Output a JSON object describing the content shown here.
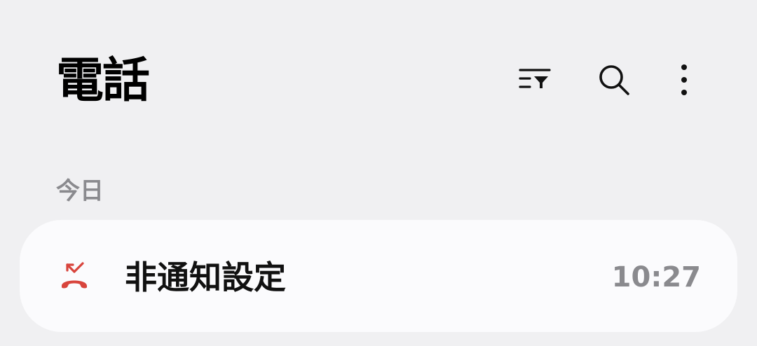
{
  "header": {
    "title": "電話",
    "actions": [
      {
        "icon": "filter-icon"
      },
      {
        "icon": "search-icon"
      },
      {
        "icon": "more-vert-icon"
      }
    ]
  },
  "sections": [
    {
      "label": "今日",
      "calls": [
        {
          "type": "rejected",
          "icon": "call-rejected-icon",
          "name": "非通知設定",
          "time": "10:27",
          "icon_color": "#d8443c"
        }
      ]
    }
  ]
}
